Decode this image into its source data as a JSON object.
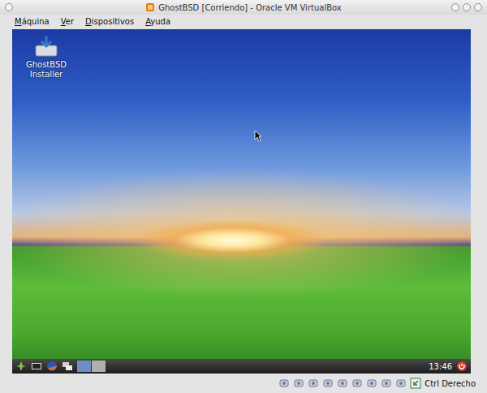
{
  "window": {
    "title": "GhostBSD [Corriendo] - Oracle VM VirtualBox"
  },
  "menu": [
    "Máquina",
    "Ver",
    "Dispositivos",
    "Ayuda"
  ],
  "guest": {
    "desktop_icons": [
      {
        "label": "GhostBSD Installer"
      }
    ],
    "taskbar": {
      "workspaces": [
        {
          "selected": true
        },
        {
          "selected": false
        }
      ],
      "clock": "13:46"
    }
  },
  "status_bar": {
    "host_key": "Ctrl Derecho"
  }
}
